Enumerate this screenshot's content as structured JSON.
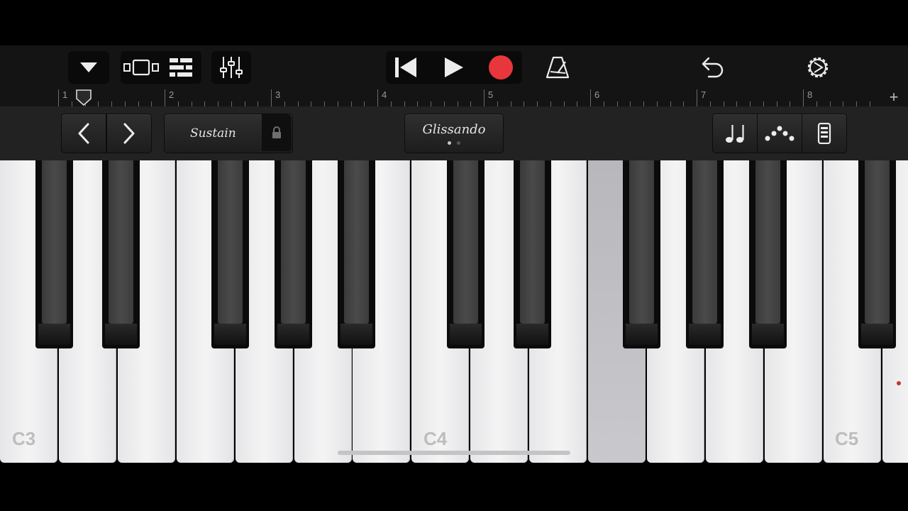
{
  "toolbar": {
    "icons": [
      "browser-menu-icon",
      "view-switch-icon",
      "tracks-view-icon",
      "mixer-icon",
      "go-to-beginning-icon",
      "play-icon",
      "record-icon",
      "metronome-icon",
      "undo-icon",
      "settings-icon"
    ],
    "colors": {
      "record": "#e8373c",
      "background": "#141414"
    }
  },
  "ruler": {
    "bars": [
      "1",
      "2",
      "3",
      "4",
      "5",
      "6",
      "7",
      "8"
    ],
    "add_label": "+"
  },
  "controls": {
    "sustain_label": "Sustain",
    "glissando_label": "Glissando",
    "glissando_page_count": 2,
    "icons": [
      "chevron-left-icon",
      "chevron-right-icon",
      "lock-icon",
      "notes-icon",
      "arpeggiator-icon",
      "keyboard-layout-icon"
    ]
  },
  "keyboard": {
    "labels": {
      "c3": "C3",
      "c4": "C4",
      "c5": "C5"
    },
    "pressed_key": "F4"
  }
}
